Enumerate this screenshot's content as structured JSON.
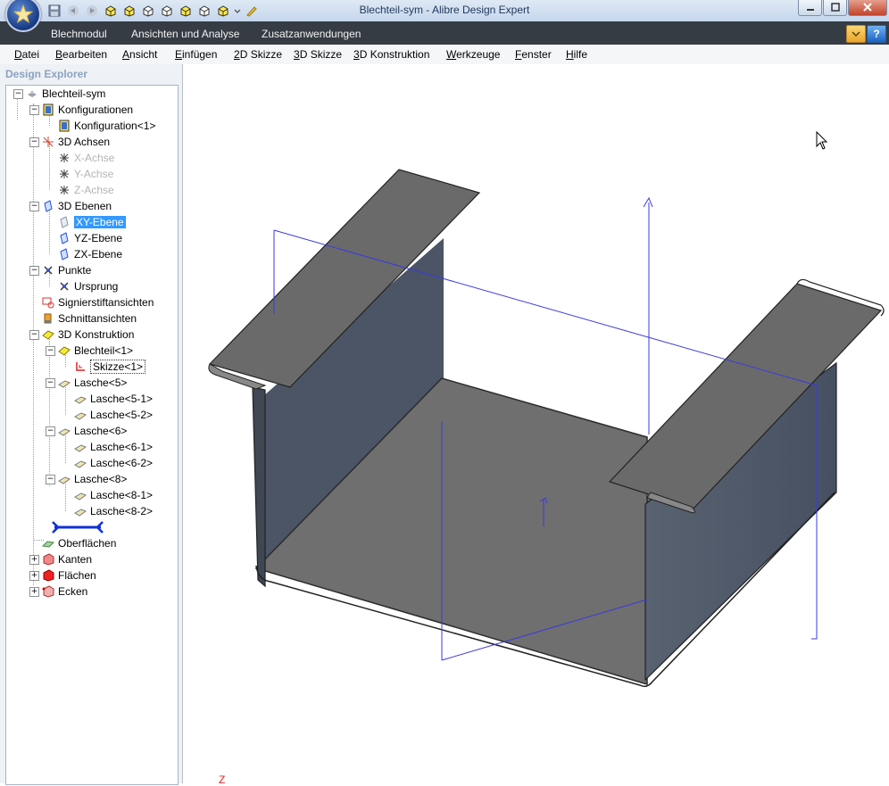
{
  "window": {
    "title": "Blechteil-sym - Alibre Design Expert"
  },
  "quick_access": [
    "save-icon",
    "undo-icon",
    "redo-icon",
    "view-cube-icon",
    "view-cube-icon",
    "view-cube-icon",
    "view-cube-icon",
    "view-cube-icon",
    "view-cube-icon",
    "view-cube-icon",
    "dropdown-icon",
    "pencil-icon"
  ],
  "ribbon": {
    "tabs": [
      "Blechmodul",
      "Ansichten und Analyse",
      "Zusatzanwendungen"
    ],
    "help_label": "?"
  },
  "menu": [
    {
      "acc": "D",
      "rest": "atei"
    },
    {
      "acc": "B",
      "rest": "earbeiten"
    },
    {
      "acc": "A",
      "rest": "nsicht"
    },
    {
      "acc": "E",
      "rest": "infügen"
    },
    {
      "acc": "2",
      "rest": "D Skizze"
    },
    {
      "acc": "3",
      "rest": "D Skizze"
    },
    {
      "acc": "3",
      "rest": "D Konstruktion"
    },
    {
      "acc": "W",
      "rest": "erkzeuge"
    },
    {
      "acc": "F",
      "rest": "enster"
    },
    {
      "acc": "H",
      "rest": "ilfe"
    }
  ],
  "explorer": {
    "title": "Design Explorer",
    "nodes": [
      {
        "label": "Blechteil-sym",
        "icon": "part-icon"
      },
      {
        "label": "Konfigurationen",
        "icon": "configurations-icon"
      },
      {
        "label": "Konfiguration<1>",
        "icon": "configuration-icon"
      },
      {
        "label": "3D Achsen",
        "icon": "axes-icon"
      },
      {
        "label": "X-Achse",
        "icon": "axis-icon",
        "state": "dim"
      },
      {
        "label": "Y-Achse",
        "icon": "axis-icon",
        "state": "dim"
      },
      {
        "label": "Z-Achse",
        "icon": "axis-icon",
        "state": "dim"
      },
      {
        "label": "3D Ebenen",
        "icon": "planes-icon"
      },
      {
        "label": "XY-Ebene",
        "icon": "plane-icon",
        "state": "selected"
      },
      {
        "label": "YZ-Ebene",
        "icon": "plane-icon"
      },
      {
        "label": "ZX-Ebene",
        "icon": "plane-icon"
      },
      {
        "label": "Punkte",
        "icon": "points-icon"
      },
      {
        "label": "Ursprung",
        "icon": "origin-icon"
      },
      {
        "label": "Signierstiftansichten",
        "icon": "redline-icon"
      },
      {
        "label": "Schnittansichten",
        "icon": "section-icon"
      },
      {
        "label": "3D Konstruktion",
        "icon": "construction-icon"
      },
      {
        "label": "Blechteil<1>",
        "icon": "sheetmetal-icon"
      },
      {
        "label": "Skizze<1>",
        "icon": "sketch-icon",
        "state": "boxed"
      },
      {
        "label": "Lasche<5>",
        "icon": "flange-icon"
      },
      {
        "label": "Lasche<5-1>",
        "icon": "flange-icon"
      },
      {
        "label": "Lasche<5-2>",
        "icon": "flange-icon"
      },
      {
        "label": "Lasche<6>",
        "icon": "flange-icon"
      },
      {
        "label": "Lasche<6-1>",
        "icon": "flange-icon"
      },
      {
        "label": "Lasche<6-2>",
        "icon": "flange-icon"
      },
      {
        "label": "Lasche<8>",
        "icon": "flange-icon"
      },
      {
        "label": "Lasche<8-1>",
        "icon": "flange-icon"
      },
      {
        "label": "Lasche<8-2>",
        "icon": "flange-icon"
      },
      {
        "label": "",
        "icon": "rollback-bar-icon"
      },
      {
        "label": "Oberflächen",
        "icon": "surfaces-icon"
      },
      {
        "label": "Kanten",
        "icon": "edges-icon"
      },
      {
        "label": "Flächen",
        "icon": "faces-icon"
      },
      {
        "label": "Ecken",
        "icon": "vertices-icon"
      }
    ]
  },
  "viewport": {
    "axis_label": "Z",
    "part_color": "#5d6673",
    "plane_color": "#3a3ae0"
  }
}
